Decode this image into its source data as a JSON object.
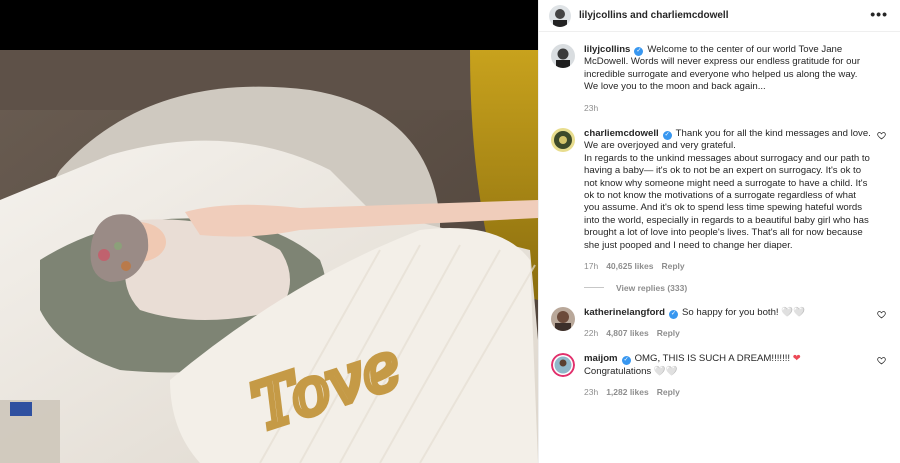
{
  "header": {
    "title": "lilyjcollins and charliemcdowell",
    "more_label": "•••"
  },
  "photo": {
    "blanket_text": "Tove"
  },
  "comments": [
    {
      "username": "lilyjcollins",
      "verified": true,
      "text": "Welcome to the center of our world Tove Jane McDowell. Words will never express our endless gratitude for our incredible surrogate and everyone who helped us along the way. We love you to the moon and back again...",
      "time": "23h"
    },
    {
      "username": "charliemcdowell",
      "verified": true,
      "text": "Thank you for all the kind messages and love. We are overjoyed and very grateful.",
      "text2": "In regards to the unkind messages about surrogacy and our path to having a baby— it's ok to not be an expert on surrogacy. It's ok to not know why someone might need a surrogate to have a child. It's ok to not know the motivations of a surrogate regardless of what you assume. And it's ok to spend less time spewing hateful words into the world, especially in regards to a beautiful baby girl who has brought a lot of love into people's lives. That's all for now because she just pooped and I need to change her diaper.",
      "time": "17h",
      "likes": "40,625 likes",
      "reply": "Reply",
      "view_replies": "View replies (333)"
    },
    {
      "username": "katherinelangford",
      "verified": true,
      "text": "So happy for you both! 🤍🤍",
      "time": "22h",
      "likes": "4,807 likes",
      "reply": "Reply"
    },
    {
      "username": "maijom",
      "verified": true,
      "text": "OMG, THIS IS SUCH A DREAM!!!!!!! ",
      "text_heart": "❤",
      "text2": "Congratulations 🤍🤍",
      "time": "23h",
      "likes": "1,282 likes",
      "reply": "Reply"
    }
  ],
  "colors": {
    "verified": "#3897f0",
    "meta": "#8e8e8e",
    "heart_red": "#ed4956"
  },
  "icons": [
    "heart-outline-icon",
    "verified-badge-icon",
    "more-options-icon"
  ]
}
